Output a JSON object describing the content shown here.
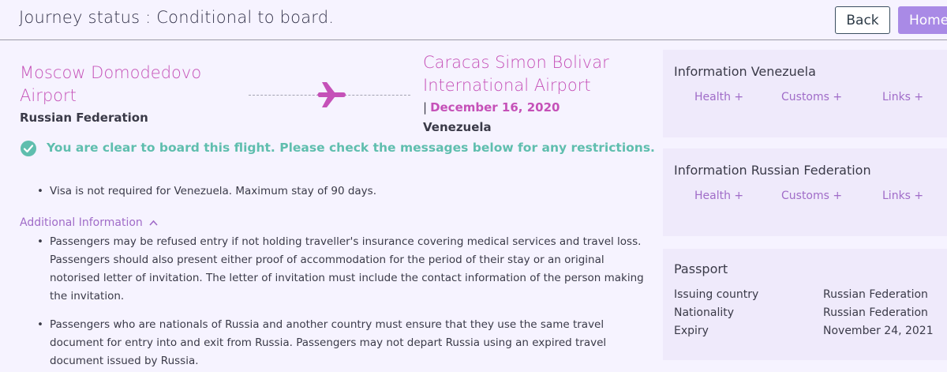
{
  "header": {
    "title": "Journey status : Conditional to board.",
    "back_label": "Back",
    "home_label": "Home"
  },
  "route": {
    "origin_airport": "Moscow Domodedovo Airport",
    "origin_country": "Russian Federation",
    "destination_airport": "Caracas Simon Bolivar International Airport",
    "date_separator": "|",
    "date": "December 16, 2020",
    "destination_country": "Venezuela"
  },
  "status": {
    "message": "You are clear to board this flight. Please check the messages below for any restrictions."
  },
  "visa": {
    "items": [
      "Visa is not required for Venezuela. Maximum stay of 90 days."
    ]
  },
  "additional": {
    "header": "Additional Information",
    "items": [
      "Passengers may be refused entry if not holding traveller's insurance covering medical services and travel loss. Passengers should also present either proof of accommodation for the period of their stay or an original notorised letter of invitation. The letter of invitation must include the contact information of the person making the invitation.",
      "Passengers who are nationals of Russia and another country must ensure that they use the same travel document for entry into and exit from Russia. Passengers may not depart Russia using an expired travel document issued by Russia."
    ]
  },
  "info_venezuela": {
    "title": "Information Venezuela",
    "links": [
      "Health +",
      "Customs +",
      "Links +"
    ]
  },
  "info_russia": {
    "title": "Information Russian Federation",
    "links": [
      "Health +",
      "Customs +",
      "Links +"
    ]
  },
  "passport": {
    "title": "Passport",
    "rows": [
      {
        "label": "Issuing country",
        "value": "Russian Federation"
      },
      {
        "label": "Nationality",
        "value": "Russian Federation"
      },
      {
        "label": "Expiry",
        "value": "November 24, 2021"
      }
    ]
  },
  "colors": {
    "accent": "#c551b8",
    "success": "#5fbeae",
    "home_button": "#a98ae6",
    "link": "#a06cc8"
  },
  "icons": {
    "plane": "airplane-icon",
    "check": "check-circle-icon",
    "chevron": "chevron-up-icon"
  }
}
